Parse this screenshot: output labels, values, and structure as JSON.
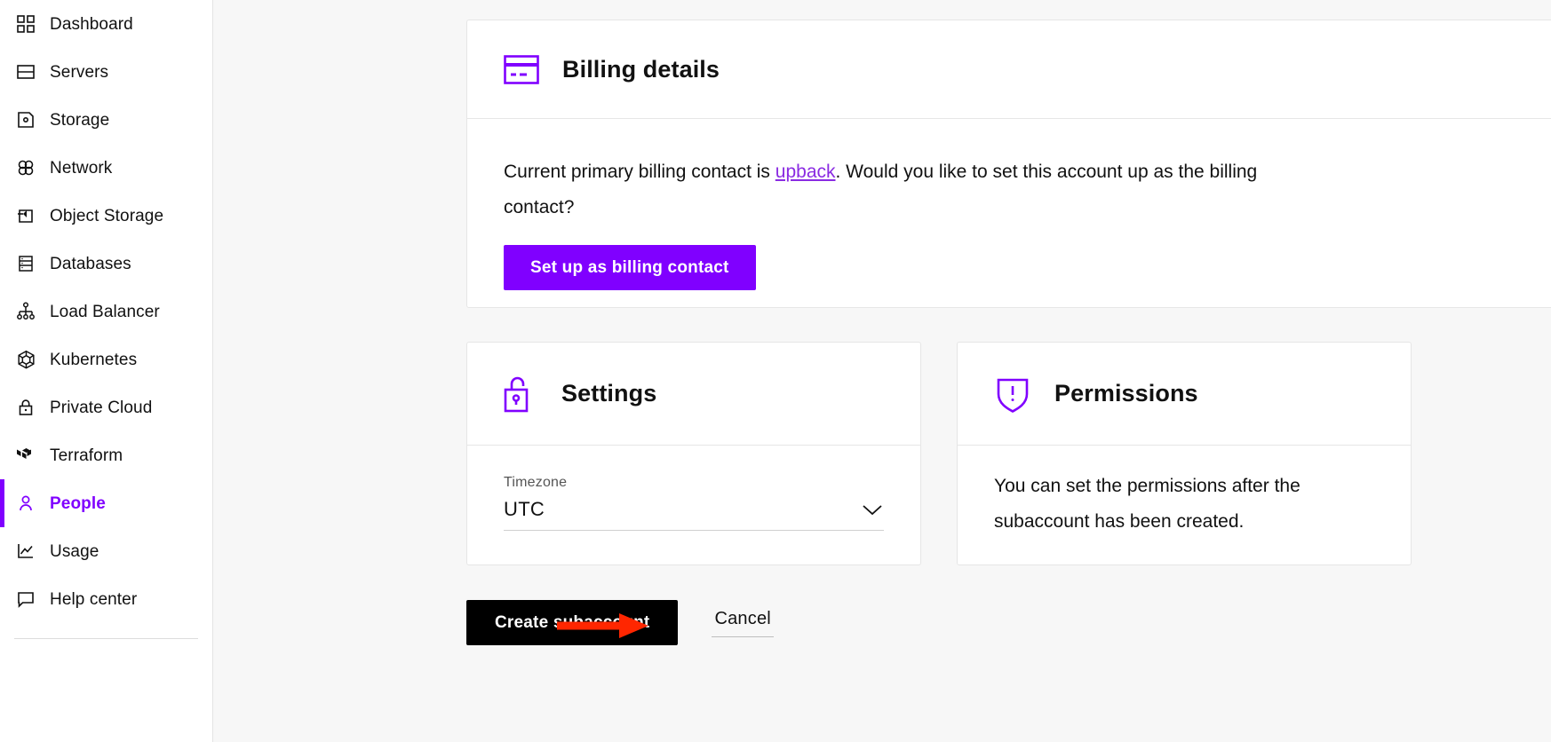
{
  "sidebar": {
    "items": [
      {
        "label": "Dashboard",
        "icon": "grid-icon",
        "active": false
      },
      {
        "label": "Servers",
        "icon": "server-icon",
        "active": false
      },
      {
        "label": "Storage",
        "icon": "storage-disk-icon",
        "active": false
      },
      {
        "label": "Network",
        "icon": "network-icon",
        "active": false
      },
      {
        "label": "Object Storage",
        "icon": "object-storage-icon",
        "active": false
      },
      {
        "label": "Databases",
        "icon": "database-icon",
        "active": false
      },
      {
        "label": "Load Balancer",
        "icon": "load-balancer-icon",
        "active": false
      },
      {
        "label": "Kubernetes",
        "icon": "kubernetes-icon",
        "active": false
      },
      {
        "label": "Private Cloud",
        "icon": "lock-icon",
        "active": false
      },
      {
        "label": "Terraform",
        "icon": "terraform-icon",
        "active": false
      },
      {
        "label": "People",
        "icon": "person-icon",
        "active": true
      },
      {
        "label": "Usage",
        "icon": "chart-line-icon",
        "active": false
      },
      {
        "label": "Help center",
        "icon": "chat-bubble-icon",
        "active": false
      }
    ],
    "active_accent_color": "#8000ff"
  },
  "billing": {
    "title": "Billing details",
    "icon": "credit-card-icon",
    "text_before_link": "Current primary billing contact is ",
    "contact_name": "upback",
    "text_after_link": ". Would you like to set this account up as the billing contact?",
    "primary_button_label": "Set up as billing contact",
    "primary_button_color": "#8000ff",
    "contact_link_color": "#8a2be2"
  },
  "settings": {
    "title": "Settings",
    "icon": "unlocked-padlock-icon",
    "timezone_label": "Timezone",
    "timezone_value": "UTC",
    "dropdown_icon": "chevron-down-icon"
  },
  "permissions": {
    "title": "Permissions",
    "icon": "shield-exclamation-icon",
    "body_text": "You can set the permissions after the subaccount has been created."
  },
  "actions": {
    "create_label": "Create subaccount",
    "create_button_color": "#000000",
    "cancel_label": "Cancel"
  },
  "annotation": {
    "arrow_color": "#ff2600",
    "points_to": "Create subaccount"
  }
}
